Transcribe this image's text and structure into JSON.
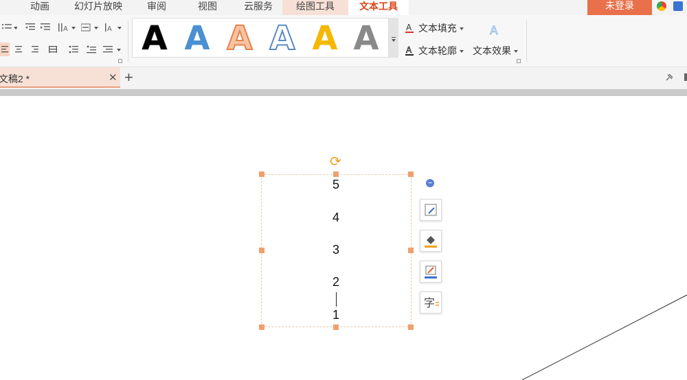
{
  "menu_tabs": [
    "动画",
    "幻灯片放映",
    "审阅",
    "视图",
    "云服务",
    "绘图工具",
    "文本工具"
  ],
  "login_label": "未登录",
  "text_fill_label": "文本填充",
  "text_outline_label": "文本轮廓",
  "text_effect_label": "文本效果",
  "art_styles": [
    {
      "glyph": "A",
      "style": "black-outline"
    },
    {
      "glyph": "A",
      "style": "blue-gradient"
    },
    {
      "glyph": "A",
      "style": "orange-outline"
    },
    {
      "glyph": "A",
      "style": "blue-outline"
    },
    {
      "glyph": "A",
      "style": "gold"
    },
    {
      "glyph": "A",
      "style": "silver-gradient"
    }
  ],
  "doc_tab_label": "文稿2 *",
  "textbox_lines": [
    "5",
    "4",
    "3",
    "2",
    "1"
  ],
  "colors": {
    "accent": "#d9481b",
    "login": "#e8704a",
    "handle": "#f0a06d",
    "drawing_tab": "#f7e1d6"
  }
}
